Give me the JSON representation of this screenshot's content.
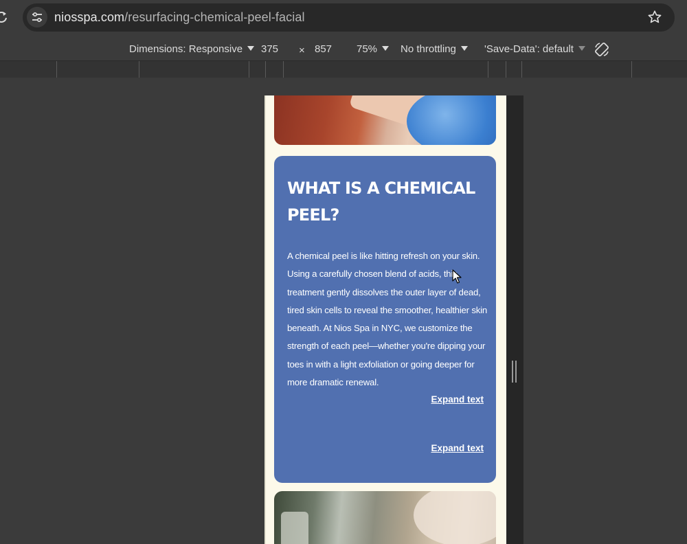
{
  "browser": {
    "url_host": "niosspa.com",
    "url_path": "/resurfacing-chemical-peel-facial"
  },
  "device_toolbar": {
    "dimensions_label": "Dimensions: Responsive",
    "width": "375",
    "times": "×",
    "height": "857",
    "zoom": "75%",
    "throttling": "No throttling",
    "save_data": "'Save-Data': default"
  },
  "page": {
    "heading": "WHAT IS A CHEMICAL PEEL?",
    "body_text": "A chemical peel is like hitting refresh on your skin. Using a carefully chosen blend of acids, this treatment gently dissolves the outer layer of dead, tired skin cells to reveal the smoother, healthier skin beneath. At Nios Spa in NYC, we customize the strength of each peel—whether you're dipping your toes in with a light exfoliation or going deeper for more dramatic renewal.",
    "expand_label_1": "Expand text",
    "expand_label_2": "Expand text"
  },
  "colors": {
    "card": "#5170b0",
    "page_bg": "#fcf9ea",
    "chrome_bg": "#3b3b3b"
  }
}
